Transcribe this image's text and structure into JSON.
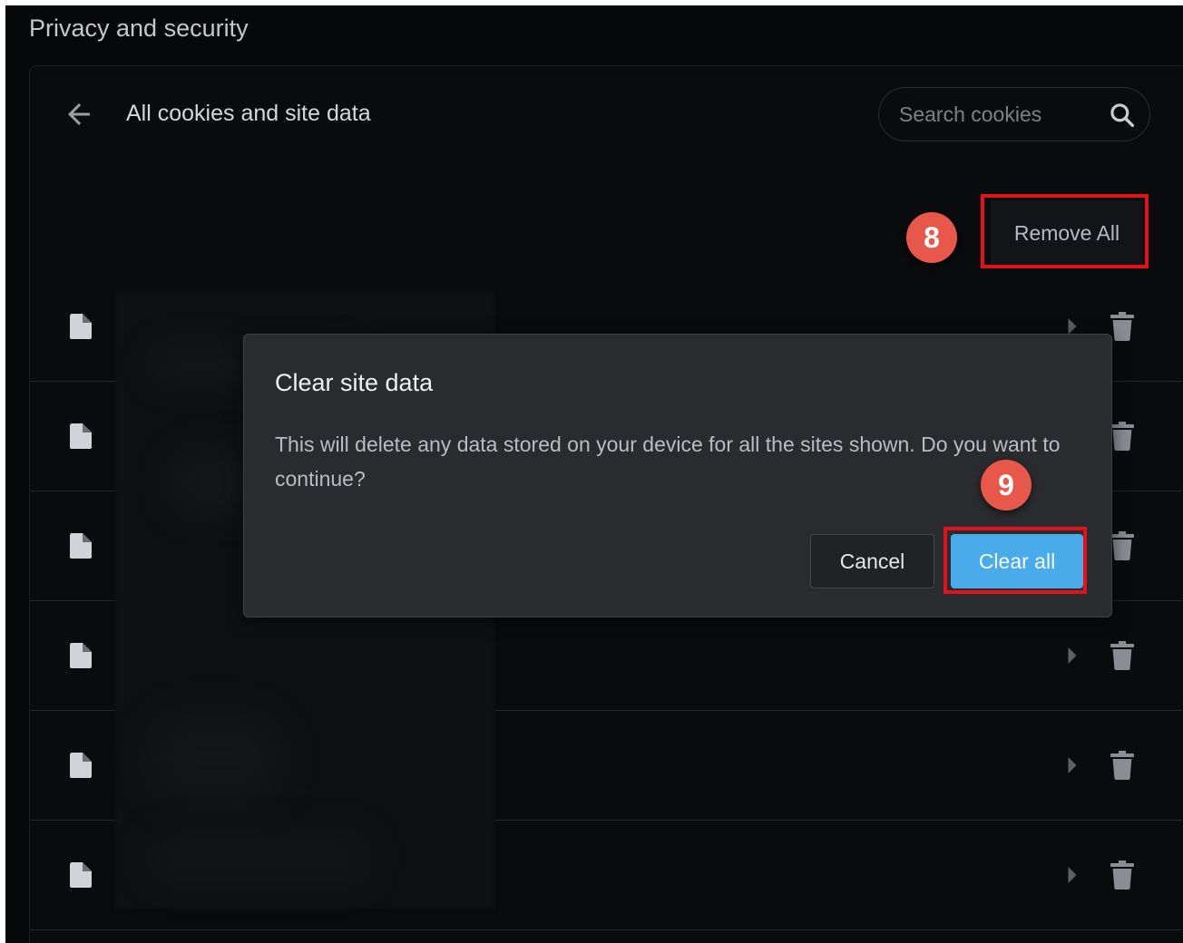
{
  "header": {
    "section_title": "Privacy and security"
  },
  "page": {
    "title": "All cookies and site data",
    "back_icon": "arrow-left-icon"
  },
  "search": {
    "placeholder": "Search cookies",
    "icon": "search-icon"
  },
  "actions": {
    "remove_all_label": "Remove All"
  },
  "rows": [
    {
      "icon": "file-icon",
      "expand_icon": "chevron-right-icon",
      "delete_icon": "trash-icon"
    },
    {
      "icon": "file-icon",
      "expand_icon": "chevron-right-icon",
      "delete_icon": "trash-icon"
    },
    {
      "icon": "file-icon",
      "expand_icon": "chevron-right-icon",
      "delete_icon": "trash-icon"
    },
    {
      "icon": "file-icon",
      "expand_icon": "chevron-right-icon",
      "delete_icon": "trash-icon"
    },
    {
      "icon": "file-icon",
      "expand_icon": "chevron-right-icon",
      "delete_icon": "trash-icon"
    },
    {
      "icon": "file-icon",
      "expand_icon": "chevron-right-icon",
      "delete_icon": "trash-icon"
    }
  ],
  "dialog": {
    "title": "Clear site data",
    "body": "This will delete any data stored on your device for all the sites shown. Do you want to continue?",
    "cancel_label": "Cancel",
    "confirm_label": "Clear all"
  },
  "annotations": [
    {
      "label": "8",
      "color": "#e8584a"
    },
    {
      "label": "9",
      "color": "#e8584a"
    }
  ],
  "colors": {
    "highlight": "#e3111a",
    "primary_button": "#4aabeb",
    "background": "#060708",
    "dialog": "#2a2b2e"
  }
}
